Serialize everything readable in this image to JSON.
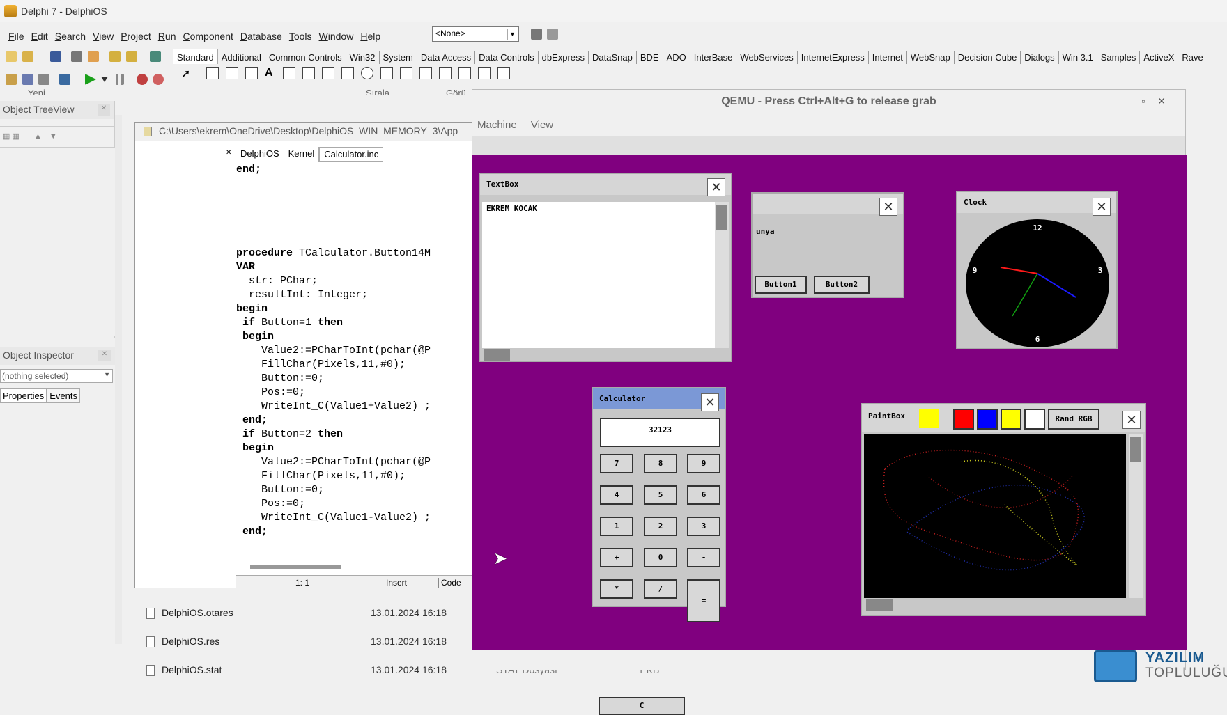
{
  "ide": {
    "title": "Delphi 7 - DelphiOS",
    "menu": [
      "File",
      "Edit",
      "Search",
      "View",
      "Project",
      "Run",
      "Component",
      "Database",
      "Tools",
      "Window",
      "Help"
    ],
    "combo_value": "<None>",
    "palette_tabs": [
      "Standard",
      "Additional",
      "Common Controls",
      "Win32",
      "System",
      "Data Access",
      "Data Controls",
      "dbExpress",
      "DataSnap",
      "BDE",
      "ADO",
      "InterBase",
      "WebServices",
      "InternetExpress",
      "Internet",
      "WebSnap",
      "Decision Cube",
      "Dialogs",
      "Win 3.1",
      "Samples",
      "ActiveX",
      "Rave"
    ],
    "active_palette_tab": "Standard",
    "hidden_toolbar_labels": [
      "Yeni",
      "Sırala",
      "Görü"
    ]
  },
  "treeview": {
    "title": "Object TreeView"
  },
  "inspector": {
    "title": "Object Inspector",
    "selection": "(nothing selected)",
    "tabs": [
      "Properties",
      "Events"
    ]
  },
  "editor": {
    "path": "C:\\Users\\ekrem\\OneDrive\\Desktop\\DelphiOS_WIN_MEMORY_3\\App",
    "tabs": [
      "DelphiOS",
      "Kernel",
      "Calculator.inc"
    ],
    "code": [
      [
        "end;"
      ],
      [
        ""
      ],
      [
        ""
      ],
      [
        ""
      ],
      [
        ""
      ],
      [
        ""
      ],
      [
        "procedure",
        " TCalculator.Button14M"
      ],
      [
        "VAR"
      ],
      [
        "  str: PChar;"
      ],
      [
        "  resultInt: Integer;"
      ],
      [
        "begin"
      ],
      [
        " if",
        " Button=1 ",
        "then"
      ],
      [
        " begin"
      ],
      [
        "    Value2:=PCharToInt(pchar(@P"
      ],
      [
        "    FillChar(Pixels,11,#0);"
      ],
      [
        "    Button:=0;"
      ],
      [
        "    Pos:=0;"
      ],
      [
        "    WriteInt_C(Value1+Value2) ;"
      ],
      [
        " end;"
      ],
      [
        " if",
        " Button=2 ",
        "then"
      ],
      [
        " begin"
      ],
      [
        "    Value2:=PCharToInt(pchar(@P"
      ],
      [
        "    FillChar(Pixels,11,#0);"
      ],
      [
        "    Button:=0;"
      ],
      [
        "    Pos:=0;"
      ],
      [
        "    WriteInt_C(Value1-Value2) ;"
      ],
      [
        " end;"
      ]
    ],
    "status_pos": "1:   1",
    "status_mode": "Insert",
    "status_tab": "Code"
  },
  "files": [
    {
      "name": "DelphiOS.otares",
      "date": "13.01.2024 16:18"
    },
    {
      "name": "DelphiOS.res",
      "date": "13.01.2024 16:18"
    },
    {
      "name": "DelphiOS.stat",
      "date": "13.01.2024 16:18",
      "type": "STAT Dosyası",
      "size": "1 KB"
    }
  ],
  "qemu": {
    "title": "QEMU - Press Ctrl+Alt+G to release grab",
    "menu": [
      "Machine",
      "View"
    ],
    "textbox": {
      "title": "TextBox",
      "content": "EKREM KOCAK"
    },
    "hidden_window": {
      "text": "unya",
      "buttons": [
        "Button1",
        "Button2"
      ]
    },
    "clock": {
      "title": "Clock",
      "numbers": [
        "12",
        "3",
        "6",
        "9"
      ]
    },
    "calculator": {
      "title": "Calculator",
      "display": "32123",
      "keys": [
        [
          "7",
          "8",
          "9"
        ],
        [
          "4",
          "5",
          "6"
        ],
        [
          "1",
          "2",
          "3"
        ],
        [
          "+",
          "0",
          "-"
        ],
        [
          "*",
          "/"
        ]
      ],
      "equals": "=",
      "clear": "C"
    },
    "paintbox": {
      "title": "PaintBox",
      "button": "Rand RGB",
      "colors": [
        "#ffff00",
        "#ff0000",
        "#0000ff",
        "#ffff00",
        "#ffffff"
      ]
    }
  },
  "watermark": {
    "line1": "YAZILIM",
    "line2": "TOPLULUĞU"
  }
}
